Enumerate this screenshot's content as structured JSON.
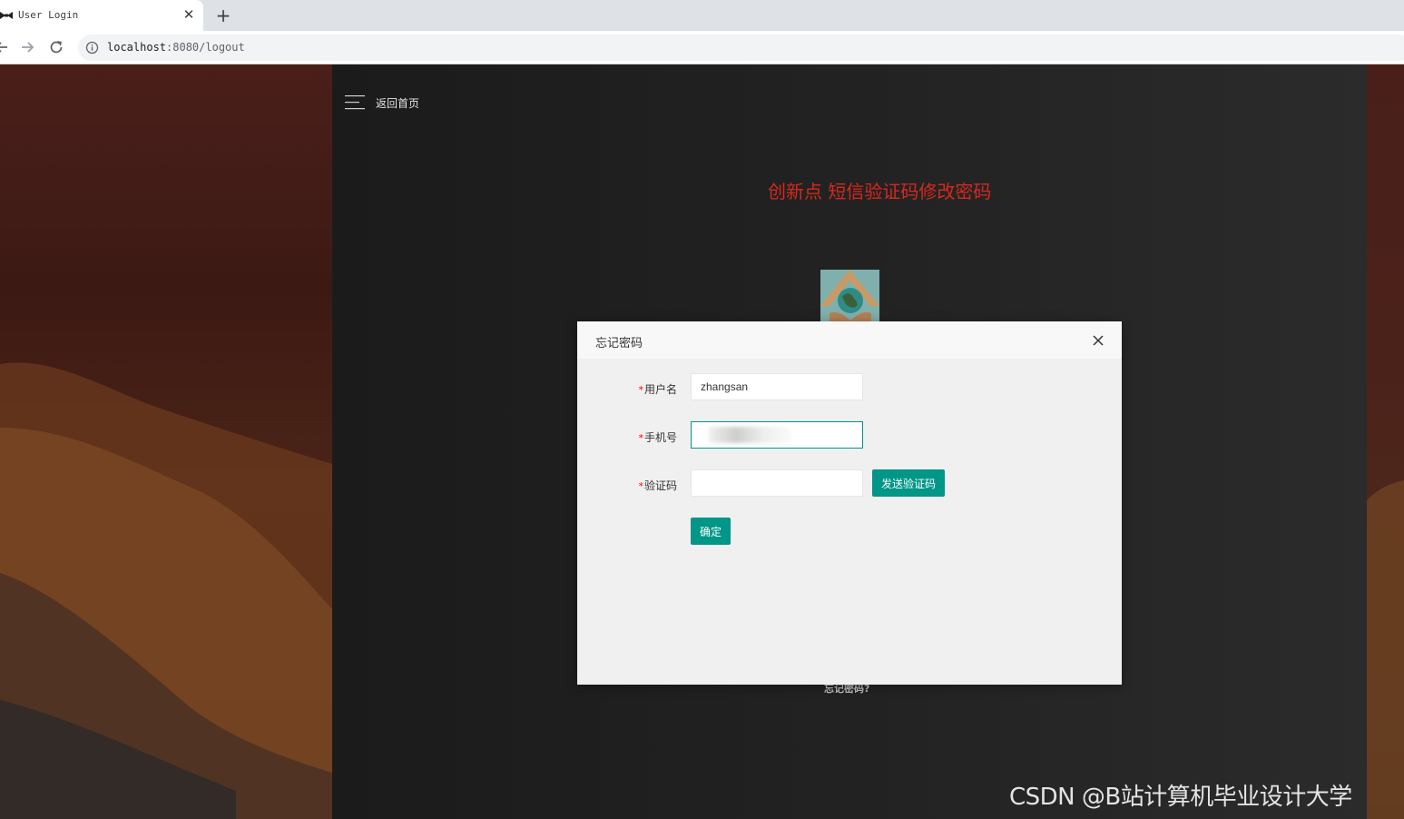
{
  "browser": {
    "tab_title": "User Login",
    "tab_close": "✕",
    "new_tab": "+",
    "url_host": "localhost",
    "url_rest": ":8080/logout"
  },
  "page": {
    "back_home": "返回首页",
    "headline": "创新点 短信验证码修改密码",
    "forgot_link": "忘记密码?",
    "watermark": "CSDN @B站计算机毕业设计大学",
    "accent_color": "#009688",
    "headline_color": "#d7281e"
  },
  "modal": {
    "title": "忘记密码",
    "required_mark": "*",
    "fields": {
      "username_label": "用户名",
      "username_value": "zhangsan",
      "phone_label": "手机号",
      "phone_value": "",
      "code_label": "验证码",
      "code_value": ""
    },
    "send_code_button": "发送验证码",
    "confirm_button": "确定"
  }
}
